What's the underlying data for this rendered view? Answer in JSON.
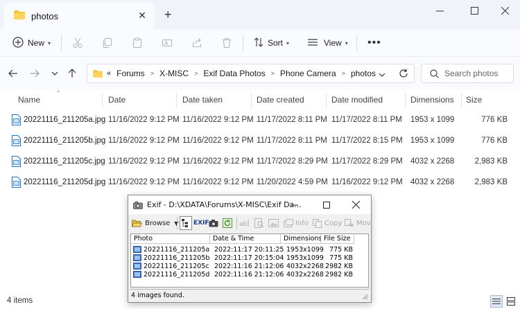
{
  "explorer": {
    "tab_title": "photos",
    "commands": {
      "new_label": "New",
      "sort_label": "Sort",
      "view_label": "View"
    },
    "breadcrumb": [
      "Forums",
      "X-MISC",
      "Exif Data Photos",
      "Phone Camera",
      "photos"
    ],
    "search_placeholder": "Search photos",
    "columns": [
      "Name",
      "Date",
      "Date taken",
      "Date created",
      "Date modified",
      "Dimensions",
      "Size"
    ],
    "files": [
      {
        "name": "20221116_211205a.jpg",
        "date": "11/16/2022 9:12 PM",
        "date_taken": "11/16/2022 9:12 PM",
        "date_created": "11/17/2022 8:11 PM",
        "date_modified": "11/17/2022 8:11 PM",
        "dimensions": "1953 x 1099",
        "size": "776 KB"
      },
      {
        "name": "20221116_211205b.jpg",
        "date": "11/16/2022 9:12 PM",
        "date_taken": "11/16/2022 9:12 PM",
        "date_created": "11/17/2022 8:11 PM",
        "date_modified": "11/17/2022 8:15 PM",
        "dimensions": "1953 x 1099",
        "size": "776 KB"
      },
      {
        "name": "20221116_211205c.jpg",
        "date": "11/16/2022 9:12 PM",
        "date_taken": "11/16/2022 9:12 PM",
        "date_created": "11/17/2022 8:29 PM",
        "date_modified": "11/17/2022 8:29 PM",
        "dimensions": "4032 x 2268",
        "size": "2,983 KB"
      },
      {
        "name": "20221116_211205d.jpg",
        "date": "11/16/2022 9:12 PM",
        "date_taken": "11/16/2022 9:12 PM",
        "date_created": "11/20/2022 4:59 PM",
        "date_modified": "11/16/2022 9:12 PM",
        "dimensions": "4032 x 2268",
        "size": "2,983 KB"
      }
    ],
    "status_text": "4 items"
  },
  "exif": {
    "title": "Exif - D:\\XDATA\\Forums\\X-MISC\\Exif Da...",
    "toolbar": {
      "browse_label": "Browse",
      "info_label": "Info",
      "copy_label": "Copy",
      "move_label": "Mov"
    },
    "columns": [
      "Photo",
      "Date & Time",
      "Dimensions",
      "File Size"
    ],
    "rows": [
      {
        "photo": "20221116_211205a",
        "datetime": "2022:11:17 20:11:25",
        "dimensions": "1953x1099",
        "size": "775 KB"
      },
      {
        "photo": "20221116_211205b",
        "datetime": "2022:11:17 20:15:04",
        "dimensions": "1953x1099",
        "size": "775 KB"
      },
      {
        "photo": "20221116_211205c",
        "datetime": "2022:11:16 21:12:06",
        "dimensions": "4032x2268",
        "size": "2982 KB"
      },
      {
        "photo": "20221116_211205d",
        "datetime": "2022:11:16 21:12:06",
        "dimensions": "4032x2268",
        "size": "2982 KB"
      }
    ],
    "status_text": "4 images found."
  },
  "colors": {
    "folder": "#f5c242",
    "accent": "#1a73c8",
    "chrome": "#f0f3f9"
  },
  "icons": [
    "folder-icon",
    "close-icon",
    "plus-icon",
    "minimize-icon",
    "maximize-icon",
    "new-icon",
    "cut-icon",
    "copy-icon",
    "paste-icon",
    "rename-icon",
    "share-icon",
    "delete-icon",
    "sort-icon",
    "view-icon",
    "more-icon",
    "back-icon",
    "forward-icon",
    "recent-icon",
    "up-icon",
    "refresh-icon",
    "search-icon",
    "jpg-file-icon"
  ]
}
